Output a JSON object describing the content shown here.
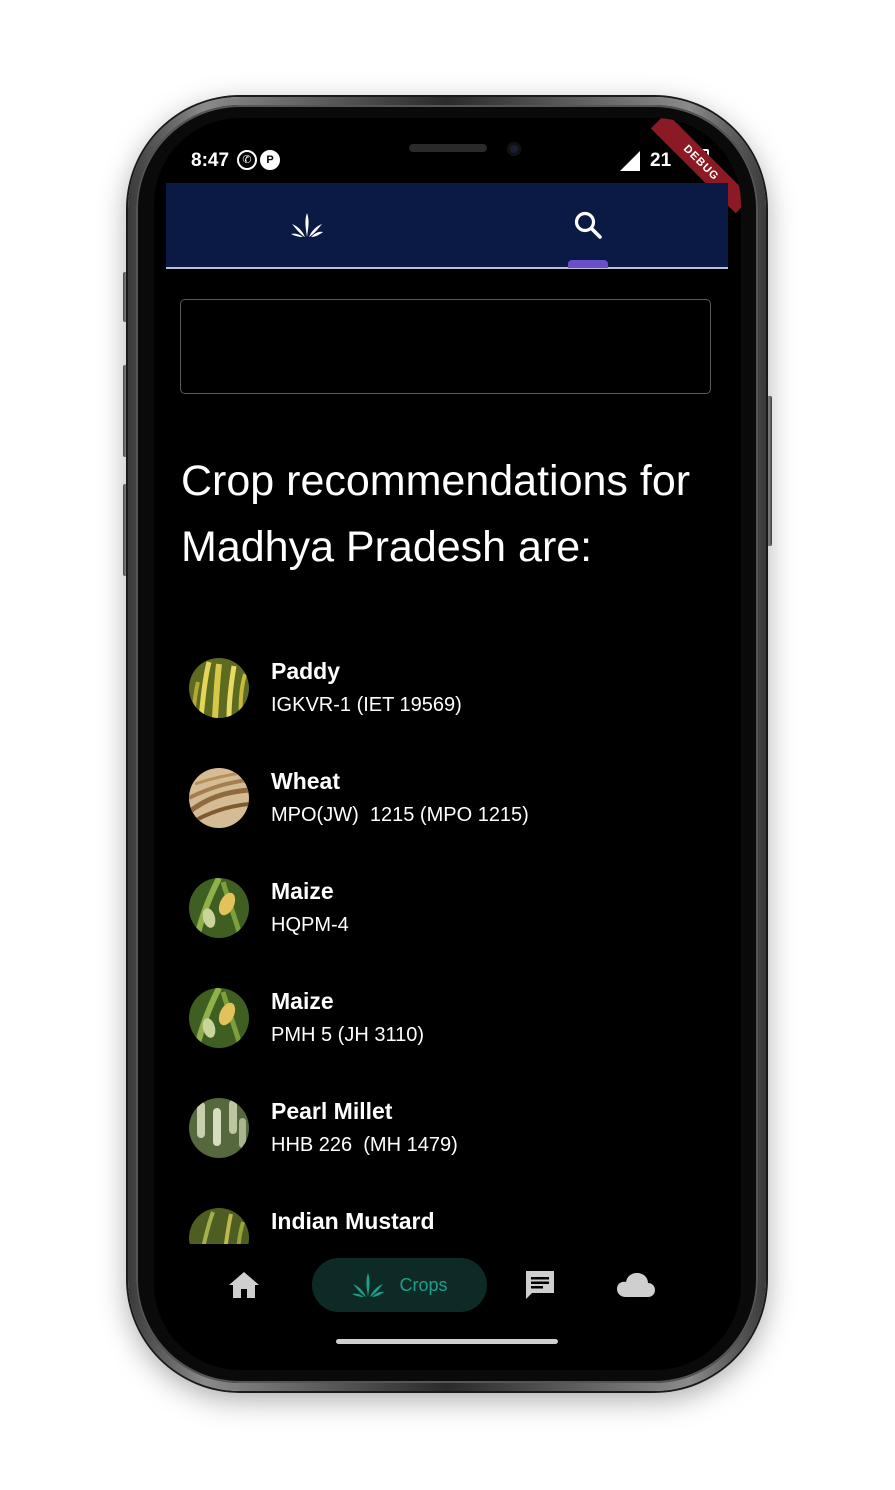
{
  "status_bar": {
    "time": "8:47",
    "battery": "21",
    "debug_label": "DEBUG"
  },
  "top_tabs": {
    "crops_icon": "crops-icon",
    "search_icon": "search-icon",
    "active": "search"
  },
  "search": {
    "value": "",
    "placeholder": ""
  },
  "heading": "Crop recommendations for Madhya Pradesh are:",
  "crops": [
    {
      "name": "Paddy",
      "variety": "IGKVR-1 (IET 19569)",
      "color": "#b8b73a"
    },
    {
      "name": "Wheat",
      "variety": "MPO(JW)  1215 (MPO 1215)",
      "color": "#c49a6a"
    },
    {
      "name": "Maize",
      "variety": "HQPM-4",
      "color": "#6d8a3a"
    },
    {
      "name": "Maize",
      "variety": "PMH 5 (JH 3110)",
      "color": "#6d8a3a"
    },
    {
      "name": "Pearl Millet",
      "variety": "HHB 226  (MH 1479)",
      "color": "#8a9a7a"
    },
    {
      "name": "Indian Mustard",
      "variety": "",
      "color": "#7a8a3a"
    }
  ],
  "bottom_nav": {
    "home_icon": "home-icon",
    "crops_label": "Crops",
    "chat_icon": "chat-icon",
    "weather_icon": "cloud-icon",
    "active_color": "#1f9e8b"
  }
}
